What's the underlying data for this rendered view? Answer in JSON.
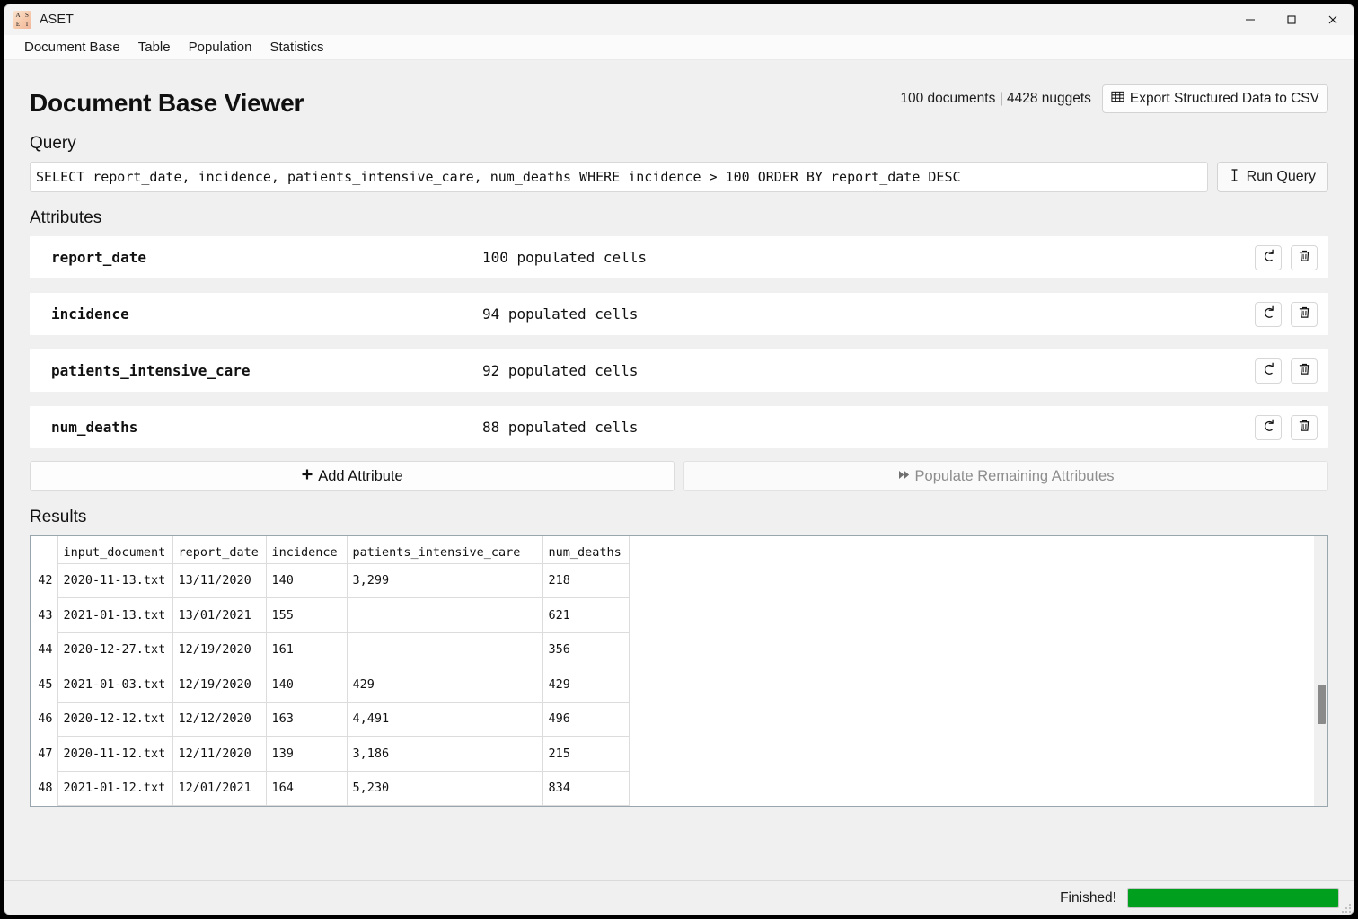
{
  "window": {
    "app_icon_letters": [
      "A",
      "S",
      "E",
      "T"
    ],
    "title": "ASET",
    "minimize": "—",
    "maximize": "□",
    "close": "✕"
  },
  "menubar": {
    "items": [
      {
        "label": "Document Base"
      },
      {
        "label": "Table"
      },
      {
        "label": "Population"
      },
      {
        "label": "Statistics"
      }
    ]
  },
  "header": {
    "title": "Document Base Viewer",
    "doc_stats": "100 documents | 4428 nuggets",
    "export_button": "Export Structured Data to CSV",
    "export_icon": "table-grid-icon"
  },
  "query": {
    "section_label": "Query",
    "value": "SELECT report_date, incidence, patients_intensive_care, num_deaths WHERE incidence > 100 ORDER BY report_date DESC",
    "run_button": "Run Query",
    "run_icon": "text-cursor-icon"
  },
  "attributes": {
    "section_label": "Attributes",
    "rows": [
      {
        "name": "report_date",
        "cells": "100 populated cells",
        "refresh_icon": "undo-icon",
        "delete_icon": "trash-icon"
      },
      {
        "name": "incidence",
        "cells": "94 populated cells",
        "refresh_icon": "undo-icon",
        "delete_icon": "trash-icon"
      },
      {
        "name": "patients_intensive_care",
        "cells": "92 populated cells",
        "refresh_icon": "undo-icon",
        "delete_icon": "trash-icon"
      },
      {
        "name": "num_deaths",
        "cells": "88 populated cells",
        "refresh_icon": "undo-icon",
        "delete_icon": "trash-icon"
      }
    ],
    "add_button": "Add Attribute",
    "add_icon": "plus-icon",
    "populate_button": "Populate Remaining Attributes",
    "populate_icon": "fast-forward-icon",
    "populate_disabled": true
  },
  "results": {
    "section_label": "Results",
    "columns": [
      "",
      "input_document",
      "report_date",
      "incidence",
      "patients_intensive_care",
      "num_deaths"
    ],
    "rows": [
      {
        "idx": "42",
        "input_document": "2020-11-13.txt",
        "report_date": "13/11/2020",
        "incidence": "140",
        "patients_intensive_care": "3,299",
        "num_deaths": "218"
      },
      {
        "idx": "43",
        "input_document": "2021-01-13.txt",
        "report_date": "13/01/2021",
        "incidence": "155",
        "patients_intensive_care": "",
        "num_deaths": "621"
      },
      {
        "idx": "44",
        "input_document": "2020-12-27.txt",
        "report_date": "12/19/2020",
        "incidence": "161",
        "patients_intensive_care": "",
        "num_deaths": "356"
      },
      {
        "idx": "45",
        "input_document": "2021-01-03.txt",
        "report_date": "12/19/2020",
        "incidence": "140",
        "patients_intensive_care": "429",
        "num_deaths": "429"
      },
      {
        "idx": "46",
        "input_document": "2020-12-12.txt",
        "report_date": "12/12/2020",
        "incidence": "163",
        "patients_intensive_care": "4,491",
        "num_deaths": "496"
      },
      {
        "idx": "47",
        "input_document": "2020-11-12.txt",
        "report_date": "12/11/2020",
        "incidence": "139",
        "patients_intensive_care": "3,186",
        "num_deaths": "215"
      },
      {
        "idx": "48",
        "input_document": "2021-01-12.txt",
        "report_date": "12/01/2021",
        "incidence": "164",
        "patients_intensive_care": "5,230",
        "num_deaths": "834"
      }
    ]
  },
  "statusbar": {
    "text": "Finished!",
    "progress_percent": 100,
    "progress_color": "#00a01e"
  }
}
